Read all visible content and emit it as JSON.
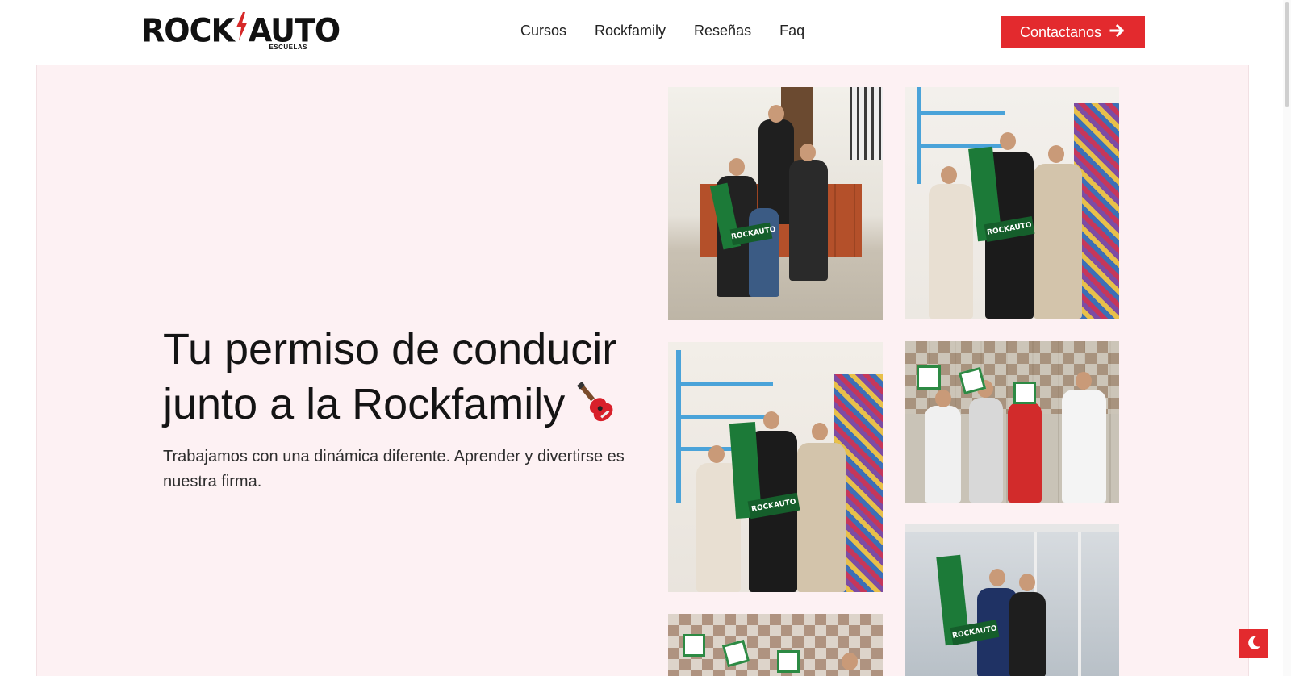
{
  "header": {
    "logo_text_left": "ROCK",
    "logo_text_right": "AUTO",
    "logo_sub": "ESCUELAS",
    "nav": [
      {
        "label": "Cursos"
      },
      {
        "label": "Rockfamily"
      },
      {
        "label": "Reseñas"
      },
      {
        "label": "Faq"
      }
    ],
    "cta_label": "Contactanos"
  },
  "hero": {
    "title_line1": "Tu permiso de conducir",
    "title_line2": "junto a la Rockfamily",
    "subtitle": "Trabajamos con una dinámica diferente. Aprender y divertirse es nuestra firma.",
    "sign_label": "ROCKAUTO"
  },
  "colors": {
    "accent": "#e32a2e",
    "hero_bg": "#fdf1f3",
    "sign_green": "#1c7a38"
  },
  "icons": {
    "cta": "arrow-right-icon",
    "toggle": "moon-icon",
    "emoji": "guitar-icon"
  }
}
